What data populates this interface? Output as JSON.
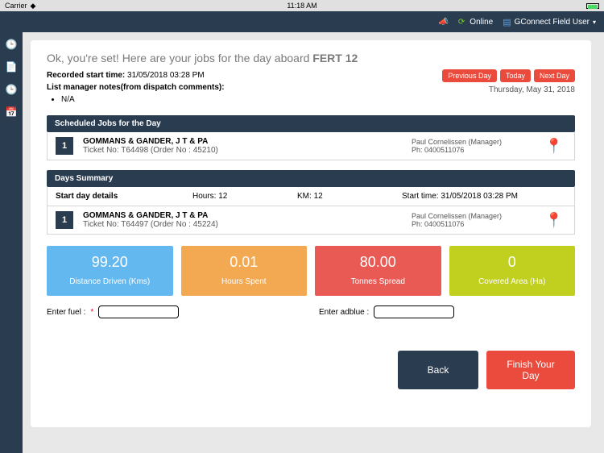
{
  "status": {
    "carrier": "Carrier",
    "time": "11:18 AM"
  },
  "appbar": {
    "online": "Online",
    "user": "GConnect Field User"
  },
  "header": {
    "greet_prefix": "Ok, you're set! Here are your jobs for the day aboard ",
    "vehicle": "FERT 12",
    "recorded_label": "Recorded start time: ",
    "recorded_value": "31/05/2018 03:28 PM",
    "notes_label": "List manager notes(from dispatch comments):",
    "notes_items": [
      "N/A"
    ],
    "date": "Thursday, May 31, 2018",
    "prev": "Previous Day",
    "today": "Today",
    "next": "Next Day"
  },
  "sections": {
    "scheduled_title": "Scheduled Jobs for the Day",
    "summary_title": "Days Summary",
    "detail_label": "Start day details",
    "hours_label": "Hours: ",
    "hours_value": "12",
    "km_label": "KM: ",
    "km_value": "12",
    "start_label": "Start time: ",
    "start_value": "31/05/2018 03:28 PM"
  },
  "jobs": [
    {
      "num": "1",
      "name": "GOMMANS & GANDER, J T & PA",
      "ticket": "Ticket No: T64498 (Order No : 45210)",
      "contact_name": "Paul Cornelissen (Manager)",
      "contact_phone": "Ph: 0400511076"
    },
    {
      "num": "1",
      "name": "GOMMANS & GANDER, J T & PA",
      "ticket": "Ticket No: T64497 (Order No : 45224)",
      "contact_name": "Paul Cornelissen (Manager)",
      "contact_phone": "Ph: 0400511076"
    }
  ],
  "stats": {
    "distance": {
      "value": "99.20",
      "label": "Distance Driven (Kms)"
    },
    "hours": {
      "value": "0.01",
      "label": "Hours Spent"
    },
    "tonnes": {
      "value": "80.00",
      "label": "Tonnes Spread"
    },
    "area": {
      "value": "0",
      "label": "Covered Area (Ha)"
    }
  },
  "fuel": {
    "fuel_label": "Enter fuel :",
    "adblue_label": "Enter adblue :"
  },
  "actions": {
    "back": "Back",
    "finish": "Finish Your Day"
  }
}
